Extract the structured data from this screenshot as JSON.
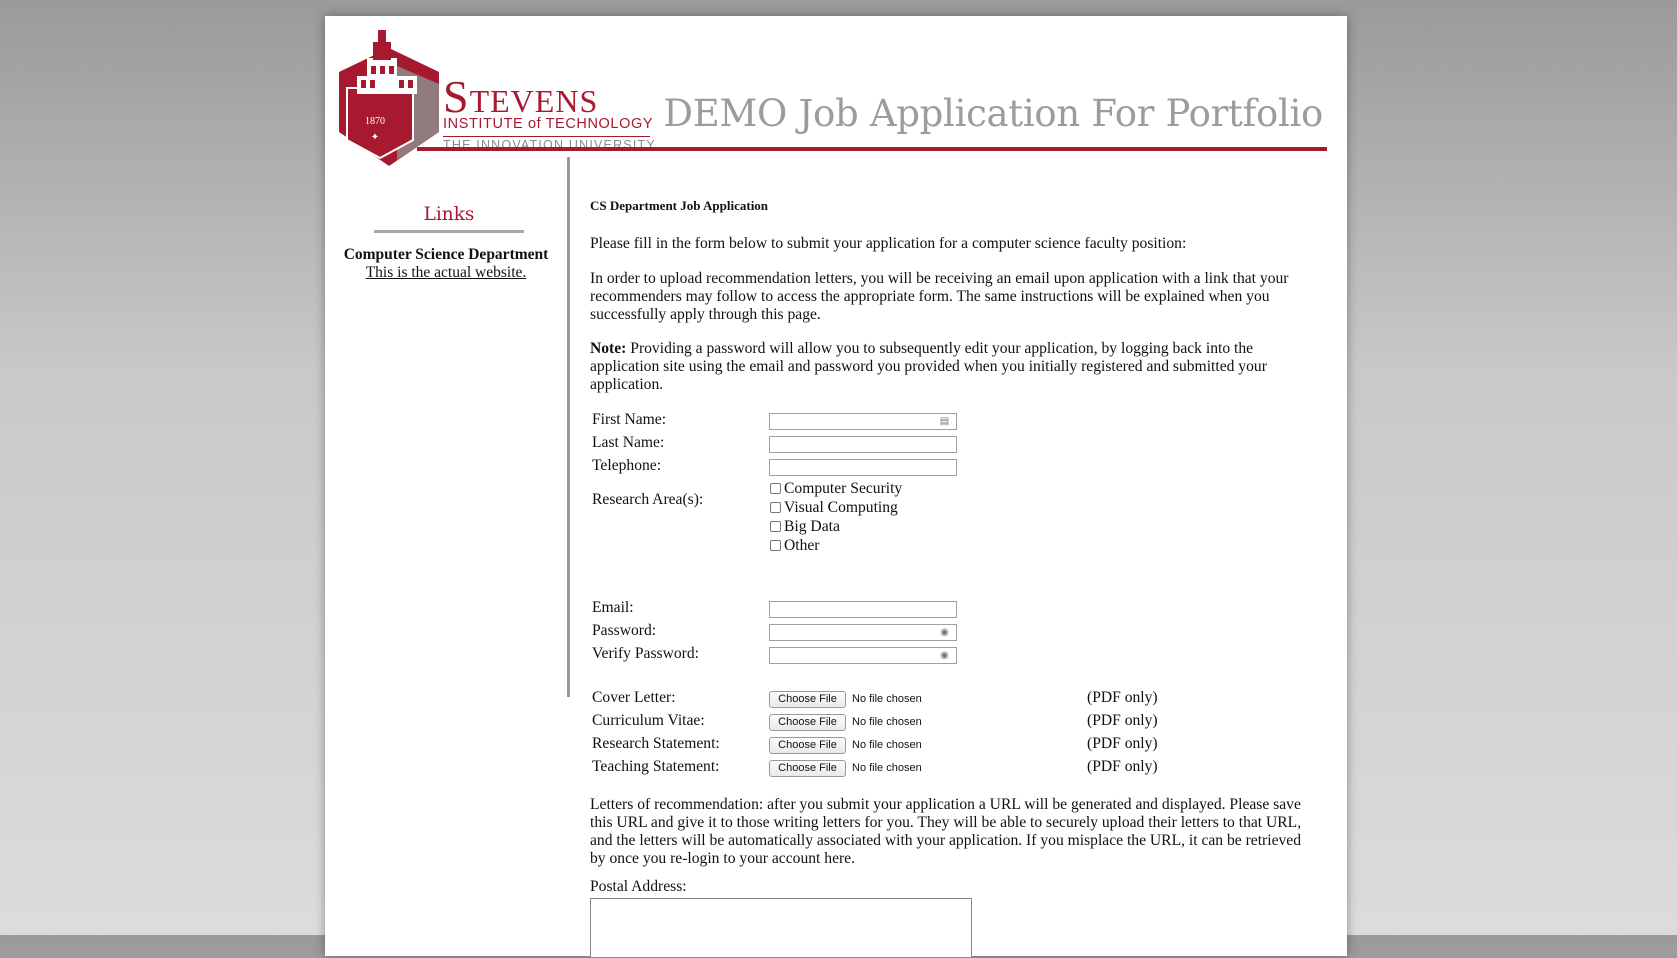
{
  "header": {
    "logo_year": "1870",
    "logo_name": "Stevens",
    "logo_sub": "INSTITUTE of TECHNOLOGY",
    "logo_tag": "THE INNOVATION UNIVERSITY",
    "site_title": "DEMO Job Application For Portfolio"
  },
  "colors": {
    "brand": "#a6192e",
    "title_gray": "#9c9c9c"
  },
  "sidebar": {
    "heading": "Links",
    "dept_name": "Computer Science Department",
    "dept_link": "This is the actual website."
  },
  "main": {
    "form_title": "CS Department Job Application",
    "intro": "Please fill in the form below to submit your application for a computer science faculty position:",
    "upload_info": "In order to upload recommendation letters, you will be receiving an email upon application with a link that your recommenders may follow to access the appropriate form. The same instructions will be explained when you successfully apply through this page.",
    "note_label": "Note:",
    "note_text": " Providing a password will allow you to subsequently edit your application, by logging back into the application site using the email and password you provided when you initially registered and submitted your application.",
    "fields": {
      "first_name": "First Name:",
      "last_name": "Last Name:",
      "telephone": "Telephone:",
      "research": "Research Area(s):",
      "email": "Email:",
      "password": "Password:",
      "verify_password": "Verify Password:"
    },
    "research_areas": [
      "Computer Security",
      "Visual Computing",
      "Big Data",
      "Other"
    ],
    "uploads": [
      {
        "label": "Cover Letter:",
        "button": "Choose File",
        "status": "No file chosen",
        "note": "(PDF only)"
      },
      {
        "label": "Curriculum Vitae:",
        "button": "Choose File",
        "status": "No file chosen",
        "note": "(PDF only)"
      },
      {
        "label": "Research Statement:",
        "button": "Choose File",
        "status": "No file chosen",
        "note": "(PDF only)"
      },
      {
        "label": "Teaching Statement:",
        "button": "Choose File",
        "status": "No file chosen",
        "note": "(PDF only)"
      }
    ],
    "letters_info": "Letters of recommendation: after you submit your application a URL will be generated and displayed. Please save this URL and give it to those writing letters for you. They will be able to securely upload their letters to that URL, and the letters will be automatically associated with your application. If you misplace the URL, it can be retrieved by once you re-login to your account here.",
    "postal_label": "Postal Address:"
  }
}
